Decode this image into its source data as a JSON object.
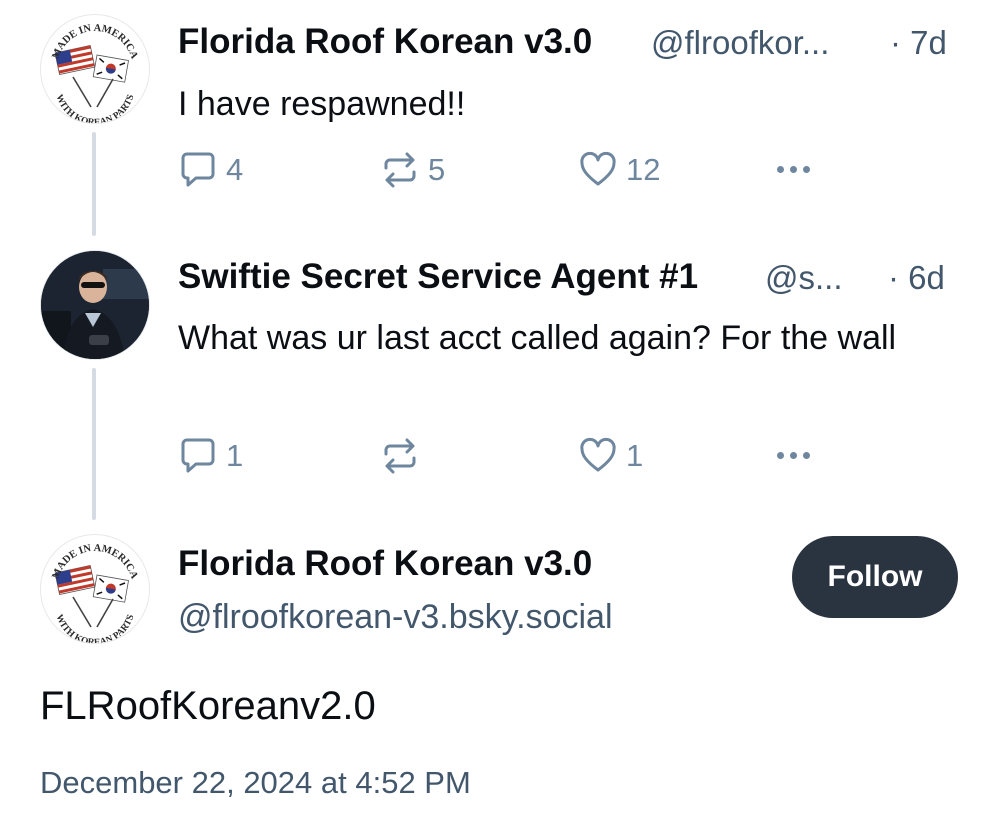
{
  "posts": [
    {
      "name": "Florida Roof Korean v3.0",
      "handle": "@flroofkor...",
      "time": "· 7d",
      "text": "I have respawned!!",
      "replies": "4",
      "reposts": "5",
      "likes": "12",
      "avatar": {
        "top_text": "MADE IN AMERICA",
        "bottom_text": "WITH KOREAN PARTS",
        "icon": "flags-badge-icon"
      }
    },
    {
      "name": "Swiftie Secret Service Agent #1",
      "handle": "@s...",
      "time": "· 6d",
      "text": "What was ur last acct called again? For the wall",
      "replies": "1",
      "reposts": "",
      "likes": "1",
      "avatar": {
        "icon": "person-photo-icon"
      }
    }
  ],
  "main_post": {
    "name": "Florida Roof Korean v3.0",
    "handle": "@flroofkorean-v3.bsky.social",
    "follow_label": "Follow",
    "text": "FLRoofKoreanv2.0",
    "timestamp": "December 22, 2024 at 4:52 PM",
    "avatar": {
      "top_text": "MADE IN AMERICA",
      "bottom_text": "WITH KOREAN PARTS",
      "icon": "flags-badge-icon"
    }
  },
  "colors": {
    "text": "#0b0f14",
    "muted": "#42576c",
    "icon": "#6f869f",
    "thread_line": "#d4dbe2",
    "follow_bg": "#2a3441"
  },
  "icons": [
    "reply-icon",
    "repost-icon",
    "like-icon",
    "more-icon"
  ]
}
